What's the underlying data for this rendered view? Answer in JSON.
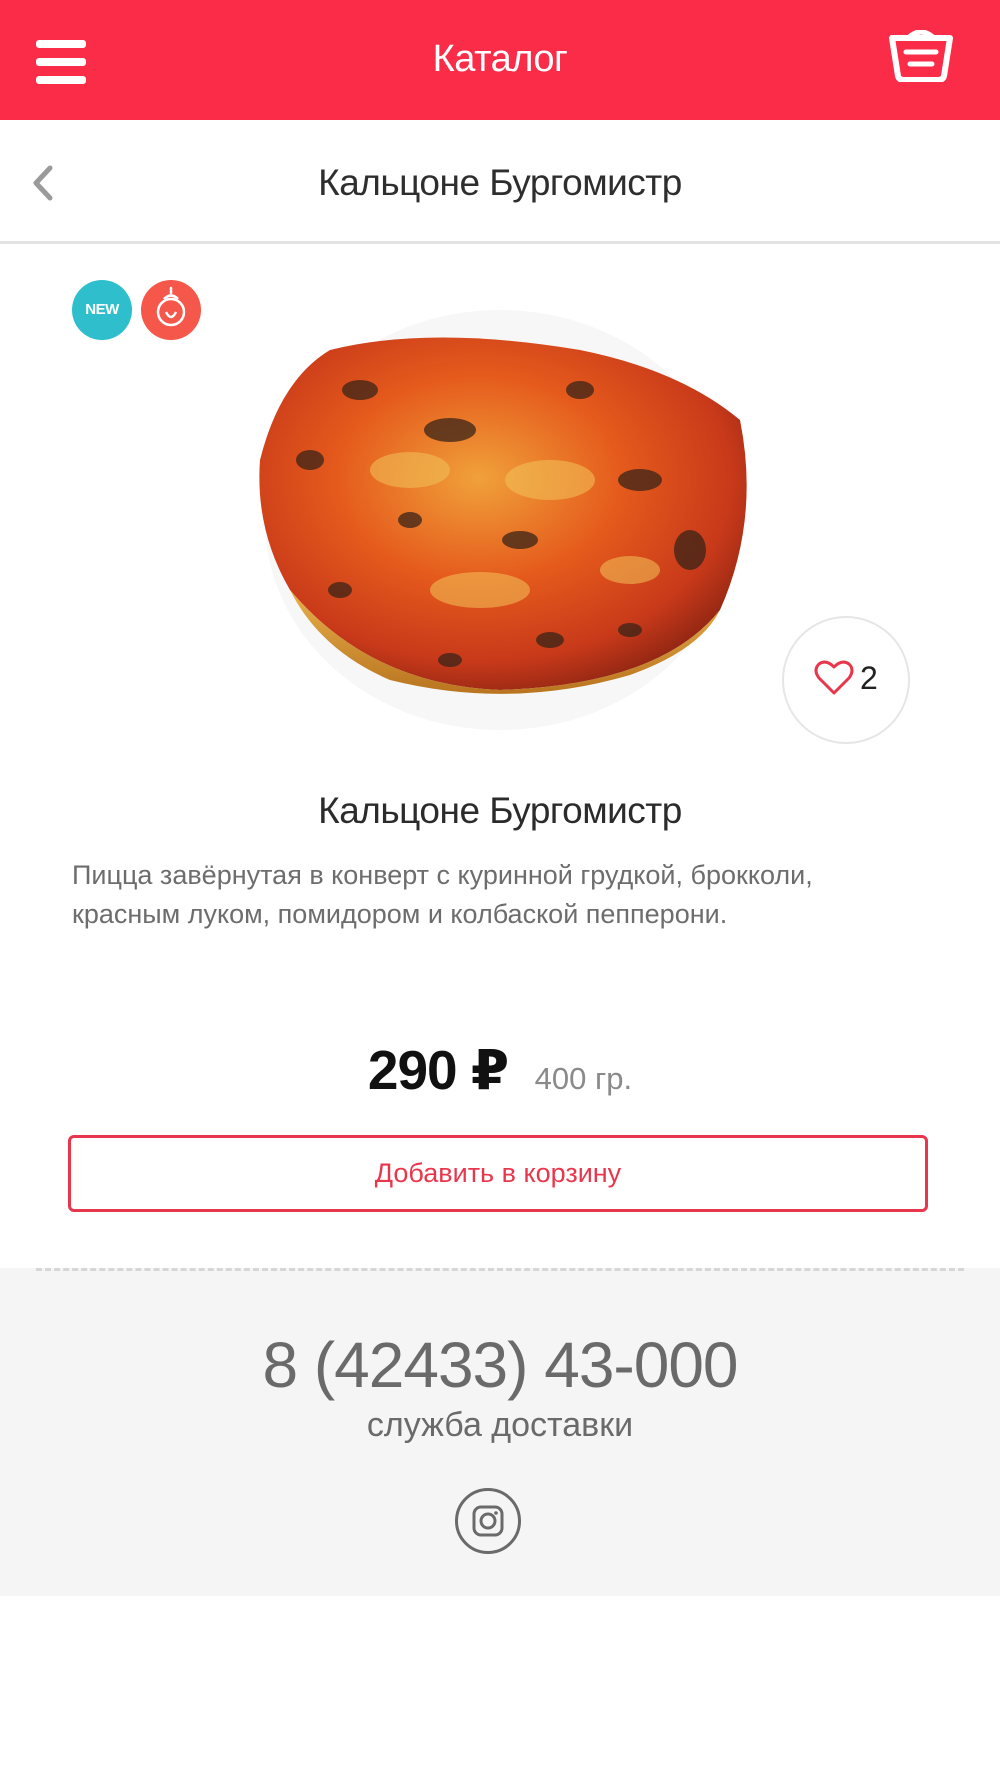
{
  "header": {
    "title": "Каталог",
    "menu_icon": "hamburger-menu-icon",
    "cart_icon": "shopping-basket-icon"
  },
  "subheader": {
    "back_icon": "chevron-left-icon",
    "title": "Кальцоне Бургомистр"
  },
  "product": {
    "badges": [
      {
        "label": "NEW",
        "icon": "new-badge",
        "color": "#2fbfcc"
      },
      {
        "icon": "spicy-pepper-icon",
        "color": "#f5584a"
      }
    ],
    "likes": "2",
    "name": "Кальцоне Бургомистр",
    "description": "Пицца завёрнутая в конверт с куринной грудкой, брокколи, красным луком, помидором и колбаской пепперони.",
    "price": "290 ₽",
    "weight": "400 гр.",
    "add_to_cart_label": "Добавить в корзину"
  },
  "footer": {
    "phone": "8 (42433) 43-000",
    "service_label": "служба доставки",
    "social_icon": "instagram-icon"
  },
  "colors": {
    "brand": "#fb2c48",
    "accent": "#e8374c",
    "new_badge": "#2fbfcc",
    "spicy_badge": "#f5584a"
  }
}
